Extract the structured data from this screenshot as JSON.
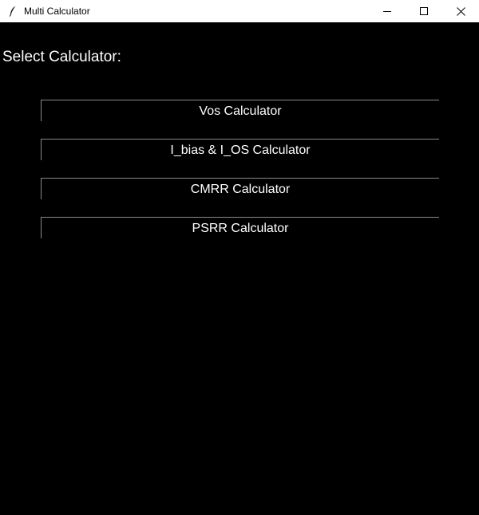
{
  "window": {
    "title": "Multi Calculator",
    "icon": "feather-icon"
  },
  "main": {
    "heading": "Select Calculator:",
    "buttons": [
      {
        "label": "Vos Calculator"
      },
      {
        "label": "I_bias & I_OS Calculator"
      },
      {
        "label": "CMRR Calculator"
      },
      {
        "label": "PSRR Calculator"
      }
    ]
  },
  "colors": {
    "background": "#000000",
    "text": "#ffffff",
    "button_border": "#8a8a8a",
    "titlebar": "#ffffff"
  }
}
